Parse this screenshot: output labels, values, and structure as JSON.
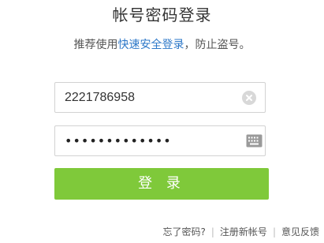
{
  "header": {
    "title": "帐号密码登录",
    "subtitle_prefix": "推荐使用",
    "subtitle_link": "快速安全登录",
    "subtitle_suffix": "，防止盗号。"
  },
  "form": {
    "account_value": "2221786958",
    "password_masked": "•••••••••••••",
    "login_label": "登 录"
  },
  "icons": {
    "clear": "clear-circle-icon",
    "keyboard": "keyboard-icon"
  },
  "footer": {
    "forgot_password": "忘了密码?",
    "register": "注册新帐号",
    "feedback": "意见反馈",
    "separator": "|"
  },
  "colors": {
    "accent_link": "#2d78c8",
    "login_button": "#7fc93a"
  }
}
